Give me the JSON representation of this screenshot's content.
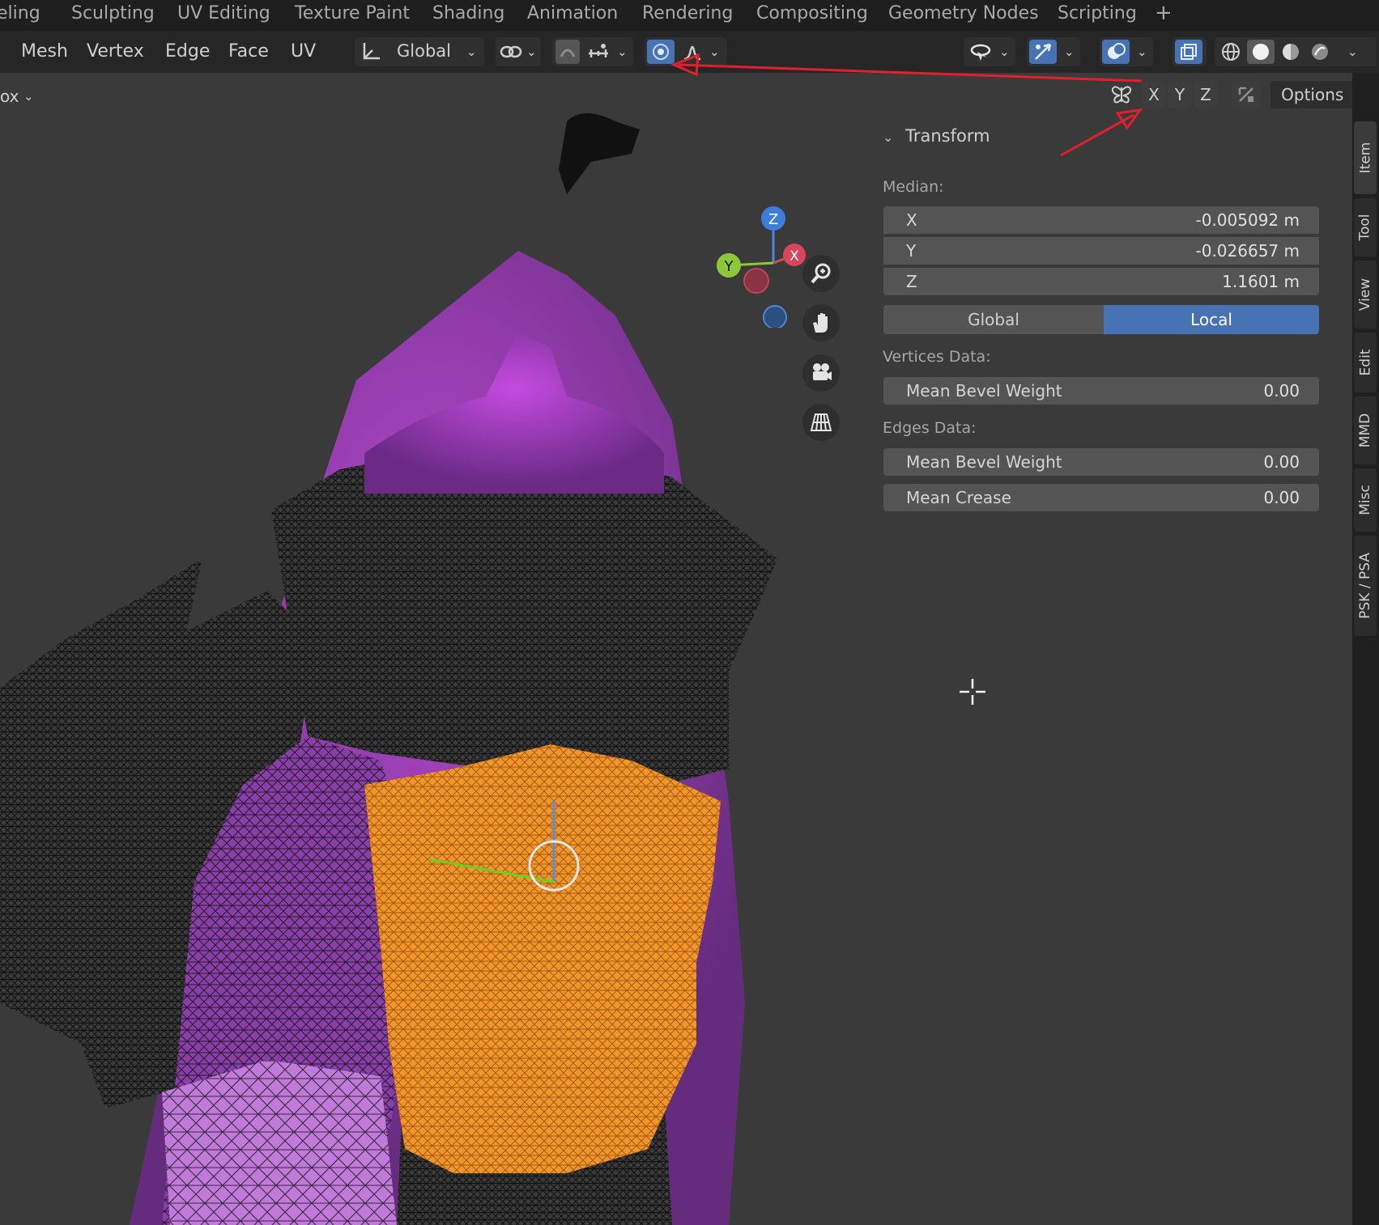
{
  "workspace_tabs": [
    "eling",
    "Sculpting",
    "UV Editing",
    "Texture Paint",
    "Shading",
    "Animation",
    "Rendering",
    "Compositing",
    "Geometry Nodes",
    "Scripting"
  ],
  "workspace_add": "+",
  "menus": [
    "Mesh",
    "Vertex",
    "Edge",
    "Face",
    "UV"
  ],
  "transform_orientation": "Global",
  "partial_menu": "ox",
  "mirror_axes": [
    "X",
    "Y",
    "Z"
  ],
  "options_label": "Options",
  "panel": {
    "title": "Transform",
    "median_label": "Median:",
    "median": [
      {
        "axis": "X",
        "value": "-0.005092 m"
      },
      {
        "axis": "Y",
        "value": "-0.026657 m"
      },
      {
        "axis": "Z",
        "value": "1.1601 m"
      }
    ],
    "space_options": [
      "Global",
      "Local"
    ],
    "space_selected": "Local",
    "vertices_data_label": "Vertices Data:",
    "vertices_mean_bevel_label": "Mean Bevel Weight",
    "vertices_mean_bevel_value": "0.00",
    "edges_data_label": "Edges Data:",
    "edges_mean_bevel_label": "Mean Bevel Weight",
    "edges_mean_bevel_value": "0.00",
    "edges_mean_crease_label": "Mean Crease",
    "edges_mean_crease_value": "0.00"
  },
  "side_tabs": [
    "Item",
    "Tool",
    "View",
    "Edit",
    "MMD",
    "Misc",
    "PSK / PSA"
  ],
  "gizmo_labels": {
    "z": "Z",
    "y": "Y",
    "x": "X"
  },
  "colors": {
    "accent_blue": "#4772b3",
    "annotation_red": "#e0202a",
    "selection_orange": "#f0962a",
    "mesh_purple": "#a63bc4"
  }
}
